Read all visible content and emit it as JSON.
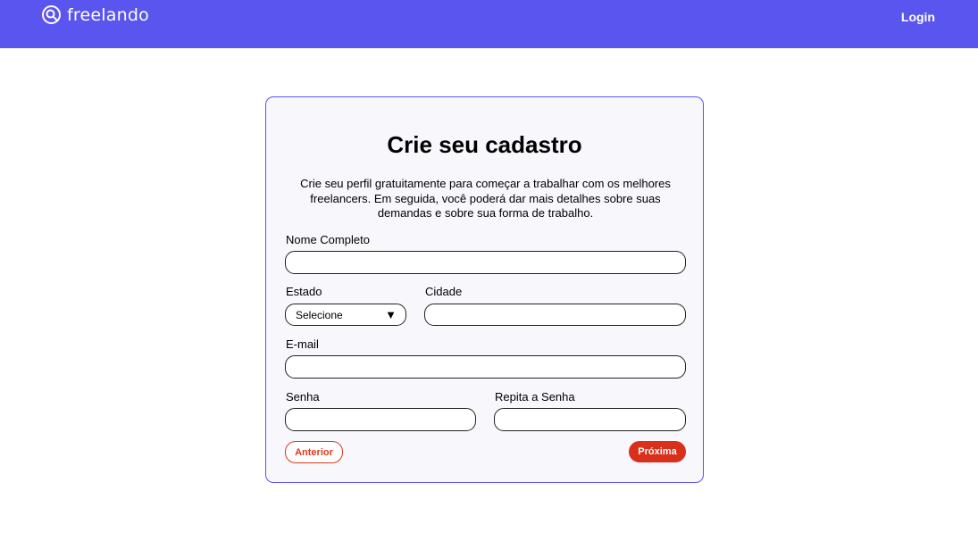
{
  "header": {
    "brand": "freelando",
    "login_label": "Login"
  },
  "form": {
    "title": "Crie seu cadastro",
    "description": "Crie seu perfil gratuitamente para começar a trabalhar com os melhores freelancers. Em seguida, você poderá dar mais detalhes sobre suas demandas e sobre sua forma de trabalho.",
    "fields": {
      "full_name": {
        "label": "Nome Completo",
        "value": ""
      },
      "state": {
        "label": "Estado",
        "selected": "Selecione"
      },
      "city": {
        "label": "Cidade",
        "value": ""
      },
      "email": {
        "label": "E-mail",
        "value": ""
      },
      "password": {
        "label": "Senha",
        "value": ""
      },
      "password_repeat": {
        "label": "Repita a Senha",
        "value": ""
      }
    },
    "buttons": {
      "previous": "Anterior",
      "next": "Próxima"
    }
  },
  "colors": {
    "header_bg": "#5b55ef",
    "card_border": "#5b55ef",
    "card_bg": "#f7f7fc",
    "accent_red": "#d8301b"
  },
  "icons": {
    "logo": "logo-icon",
    "select_caret": "caret-down-icon"
  }
}
